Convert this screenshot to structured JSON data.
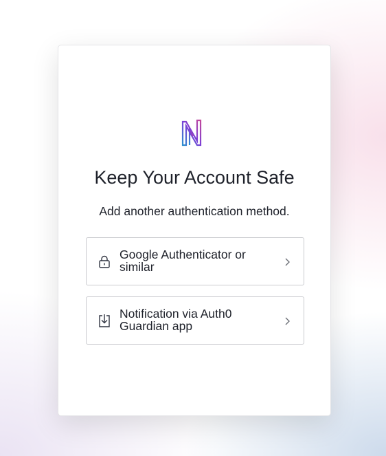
{
  "header": {
    "logo_icon": "brand-n-logo-icon",
    "title": "Keep Your Account Safe",
    "subtitle": "Add another authentication method."
  },
  "options": [
    {
      "label": "Google Authenticator or similar",
      "icon": "lock-icon"
    },
    {
      "label": "Notification via Auth0 Guardian app",
      "icon": "download-icon"
    }
  ],
  "colors": {
    "text": "#1e212a",
    "border": "#c9cace",
    "logo_gradient": [
      "#2b8fcf",
      "#7b3fd6",
      "#c2479a"
    ]
  }
}
